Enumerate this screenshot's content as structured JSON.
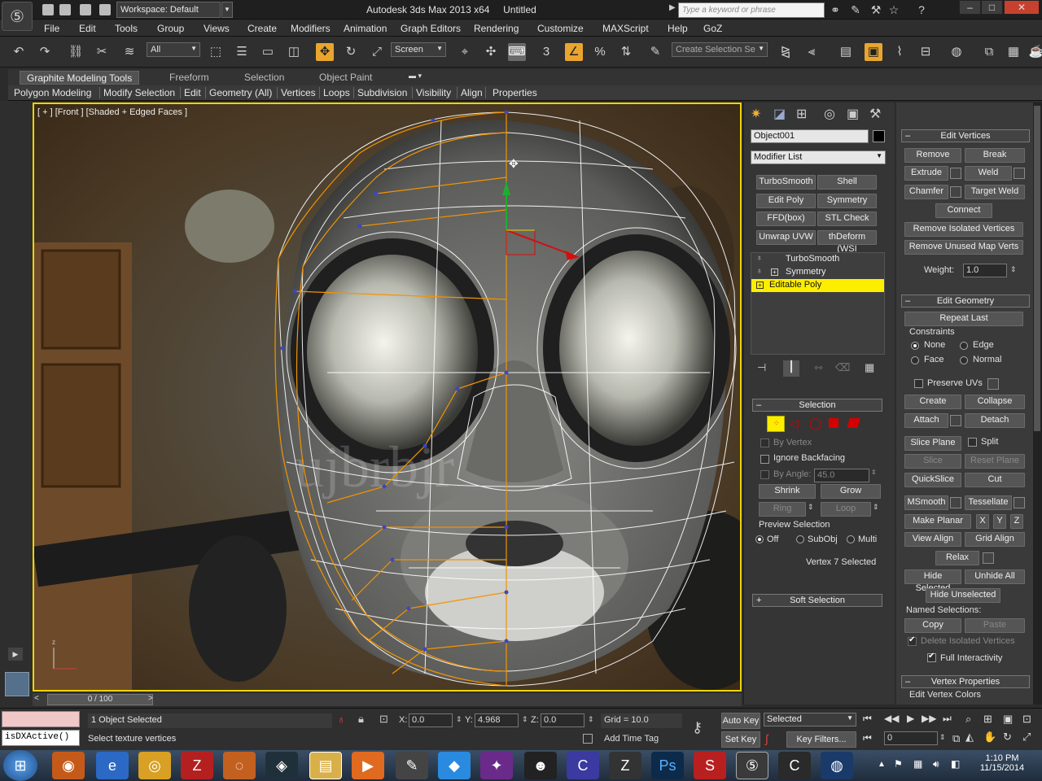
{
  "title": {
    "workspace": "Workspace: Default",
    "window_title": "Autodesk 3ds Max  2013 x64",
    "document": "Untitled",
    "search_placeholder": "Type a keyword or phrase",
    "min": "–",
    "max": "□",
    "close": "✕"
  },
  "menu": [
    "File",
    "Edit",
    "Tools",
    "Group",
    "Views",
    "Create",
    "Modifiers",
    "Animation",
    "Graph Editors",
    "Rendering",
    "Customize",
    "MAXScript",
    "Help",
    "GoZ"
  ],
  "toolbar": {
    "selection_filter": "All",
    "ref_coord": "Screen",
    "named_selection_placeholder": "Create Selection Se",
    "snap_label": "3"
  },
  "ribbon": {
    "tabs": [
      "Graphite Modeling Tools",
      "Freeform",
      "Selection",
      "Object Paint"
    ],
    "sub": [
      "Polygon Modeling",
      "Modify Selection",
      "Edit",
      "Geometry (All)",
      "Vertices",
      "Loops",
      "Subdivision",
      "Visibility",
      "Align",
      "Properties"
    ]
  },
  "viewport": {
    "label": "[ + ] [Front ] [Shaded + Edged Faces ]",
    "watermark": "ujbrbjr"
  },
  "timeline": {
    "frame": "0 / 100"
  },
  "command_panel": {
    "object_name": "Object001",
    "modifier_list": "Modifier List",
    "modifier_buttons": [
      "TurboSmooth",
      "Shell",
      "Edit Poly",
      "Symmetry",
      "FFD(box)",
      "STL Check",
      "Unwrap UVW",
      "thDeform (WSI"
    ],
    "stack": [
      "TurboSmooth",
      "Symmetry",
      "Editable Poly"
    ],
    "selection": {
      "header": "Selection",
      "by_vertex": "By Vertex",
      "ignore_backfacing": "Ignore Backfacing",
      "by_angle": "By Angle:",
      "angle_value": "45.0",
      "shrink": "Shrink",
      "grow": "Grow",
      "ring": "Ring",
      "loop": "Loop",
      "preview_selection": "Preview Selection",
      "off": "Off",
      "subobj": "SubObj",
      "multi": "Multi",
      "status": "Vertex 7 Selected"
    },
    "soft_selection": "Soft Selection"
  },
  "edit_vertices": {
    "header": "Edit Vertices",
    "remove": "Remove",
    "break": "Break",
    "extrude": "Extrude",
    "weld": "Weld",
    "chamfer": "Chamfer",
    "target_weld": "Target Weld",
    "connect": "Connect",
    "remove_isolated": "Remove Isolated Vertices",
    "remove_unused": "Remove Unused Map Verts",
    "weight_label": "Weight:",
    "weight_value": "1.0"
  },
  "edit_geometry": {
    "header": "Edit Geometry",
    "repeat_last": "Repeat Last",
    "constraints": "Constraints",
    "none": "None",
    "edge": "Edge",
    "face": "Face",
    "normal": "Normal",
    "preserve_uvs": "Preserve UVs",
    "create": "Create",
    "collapse": "Collapse",
    "attach": "Attach",
    "detach": "Detach",
    "slice_plane": "Slice Plane",
    "split": "Split",
    "slice": "Slice",
    "reset_plane": "Reset Plane",
    "quickslice": "QuickSlice",
    "cut": "Cut",
    "msmooth": "MSmooth",
    "tessellate": "Tessellate",
    "make_planar": "Make Planar",
    "x": "X",
    "y": "Y",
    "z": "Z",
    "view_align": "View Align",
    "grid_align": "Grid Align",
    "relax": "Relax",
    "hide_selected": "Hide Selected",
    "unhide_all": "Unhide All",
    "hide_unselected": "Hide Unselected",
    "named_selections": "Named Selections:",
    "copy": "Copy",
    "paste": "Paste",
    "delete_isolated": "Delete Isolated Vertices",
    "full_interactivity": "Full Interactivity"
  },
  "vertex_properties": {
    "header": "Vertex Properties",
    "edit_colors": "Edit Vertex Colors"
  },
  "status": {
    "maxscript": "isDXActive()",
    "objects_selected": "1 Object Selected",
    "prompt": "Select texture vertices",
    "x_label": "X:",
    "x": "0.0",
    "y_label": "Y:",
    "y": "4.968",
    "z_label": "Z:",
    "z": "0.0",
    "grid": "Grid = 10.0",
    "add_time_tag": "Add Time Tag",
    "auto_key": "Auto Key",
    "set_key": "Set Key",
    "key_mode": "Selected",
    "key_filters": "Key Filters...",
    "frame_field": "0"
  },
  "clock": {
    "time": "1:10 PM",
    "date": "11/15/2014"
  },
  "colors": {
    "accent": "#f0d400",
    "active_tool": "#e9a52e",
    "selection_highlight": "#fdee00",
    "vertex_selection_red": "#d40000"
  }
}
